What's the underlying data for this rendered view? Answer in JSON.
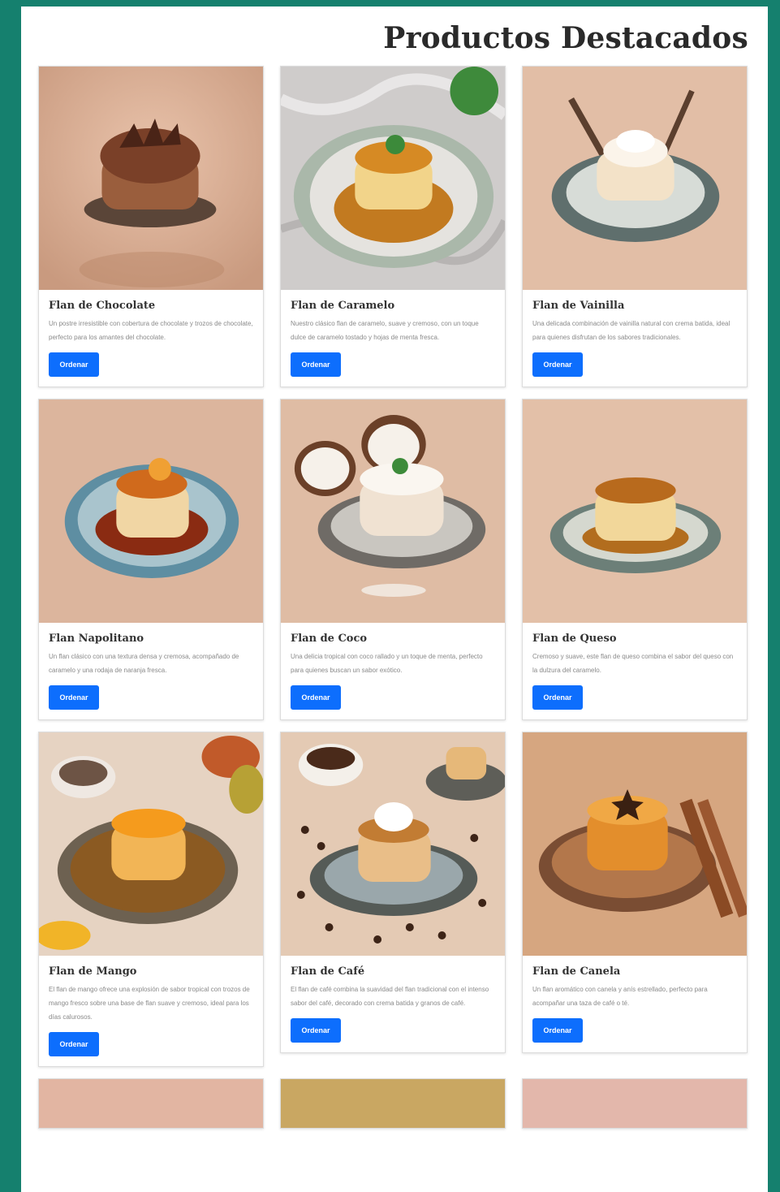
{
  "header": {
    "title": "Productos Destacados"
  },
  "colors": {
    "background": "#15806e",
    "button": "#0d6efd"
  },
  "products": [
    {
      "name": "Flan de Chocolate",
      "description": "Un postre irresistible con cobertura de chocolate y trozos de chocolate, perfecto para los amantes del chocolate.",
      "button": "Ordenar",
      "image": "chocolate-flan-image"
    },
    {
      "name": "Flan de Caramelo",
      "description": "Nuestro clásico flan de caramelo, suave y cremoso, con un toque dulce de caramelo tostado y hojas de menta fresca.",
      "button": "Ordenar",
      "image": "caramel-flan-image"
    },
    {
      "name": "Flan de Vainilla",
      "description": "Una delicada combinación de vainilla natural con crema batida, ideal para quienes disfrutan de los sabores tradicionales.",
      "button": "Ordenar",
      "image": "vanilla-flan-image"
    },
    {
      "name": "Flan Napolitano",
      "description": "Un flan clásico con una textura densa y cremosa, acompañado de caramelo y una rodaja de naranja fresca.",
      "button": "Ordenar",
      "image": "napolitano-flan-image"
    },
    {
      "name": "Flan de Coco",
      "description": "Una delicia tropical con coco rallado y un toque de menta, perfecto para quienes buscan un sabor exótico.",
      "button": "Ordenar",
      "image": "coconut-flan-image"
    },
    {
      "name": "Flan de Queso",
      "description": "Cremoso y suave, este flan de queso combina el sabor del queso con la dulzura del caramelo.",
      "button": "Ordenar",
      "image": "cheese-flan-image"
    },
    {
      "name": "Flan de Mango",
      "description": "El flan de mango ofrece una explosión de sabor tropical con trozos de mango fresco sobre una base de flan suave y cremoso, ideal para los días calurosos.",
      "button": "Ordenar",
      "image": "mango-flan-image"
    },
    {
      "name": "Flan de Café",
      "description": "El flan de café combina la suavidad del flan tradicional con el intenso sabor del café, decorado con crema batida y granos de café.",
      "button": "Ordenar",
      "image": "coffee-flan-image"
    },
    {
      "name": "Flan de Canela",
      "description": "Un flan aromático con canela y anís estrellado, perfecto para acompañar una taza de café o té.",
      "button": "Ordenar",
      "image": "cinnamon-flan-image"
    }
  ]
}
